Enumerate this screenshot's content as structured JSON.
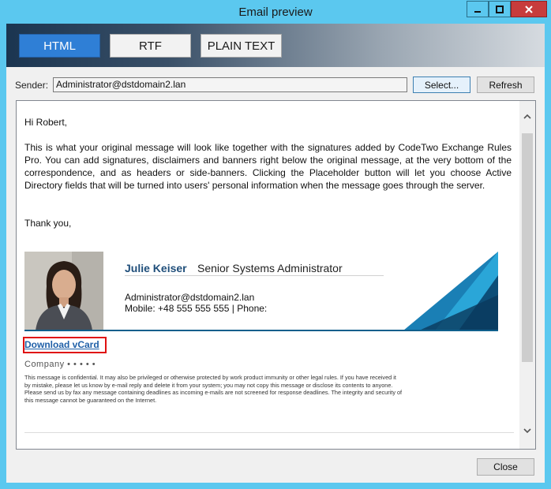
{
  "window": {
    "title": "Email preview",
    "controls": {
      "minimize": "minimize",
      "maximize": "maximize",
      "close": "close"
    }
  },
  "format_tabs": [
    {
      "label": "HTML",
      "selected": true
    },
    {
      "label": "RTF",
      "selected": false
    },
    {
      "label": "PLAIN TEXT",
      "selected": false
    }
  ],
  "sender": {
    "label": "Sender:",
    "value": "Administrator@dstdomain2.lan",
    "select_label": "Select...",
    "refresh_label": "Refresh"
  },
  "message": {
    "greeting": "Hi Robert,",
    "body": "This is what your original message will look like together with the signatures added by CodeTwo Exchange Rules Pro. You can add signatures, disclaimers and banners right below the original message, at the very bottom of the correspondence, and as headers or side-banners. Clicking the Placeholder button will let you choose Active Directory fields that will be turned into users' personal information when the message goes through the server.",
    "closing": "Thank you,"
  },
  "signature": {
    "name": "Julie Keiser",
    "role": "Senior Systems Administrator",
    "email": "Administrator@dstdomain2.lan",
    "mobile": "Mobile:  +48 555 555 555 | Phone:",
    "vcard_link": "Download vCard",
    "company": "Company • •   • • •",
    "disclaimer": "This message is confidential. It may also be privileged or otherwise protected by work product immunity or other legal rules. If you have received it by mistake, please let us know by e-mail reply and delete it from your system; you may not copy this message or disclose its contents to anyone. Please send us by fax any message containing deadlines as incoming e-mails are not screened for response deadlines. The integrity and security of this message cannot be guaranteed on the Internet.",
    "accent_color": "#0f5f8c"
  },
  "footer": {
    "close_label": "Close"
  },
  "colors": {
    "titlebar": "#5bc8ef",
    "selected_tab": "#2f7fd6",
    "close_button": "#c73c3c",
    "highlight": "#e01010"
  }
}
